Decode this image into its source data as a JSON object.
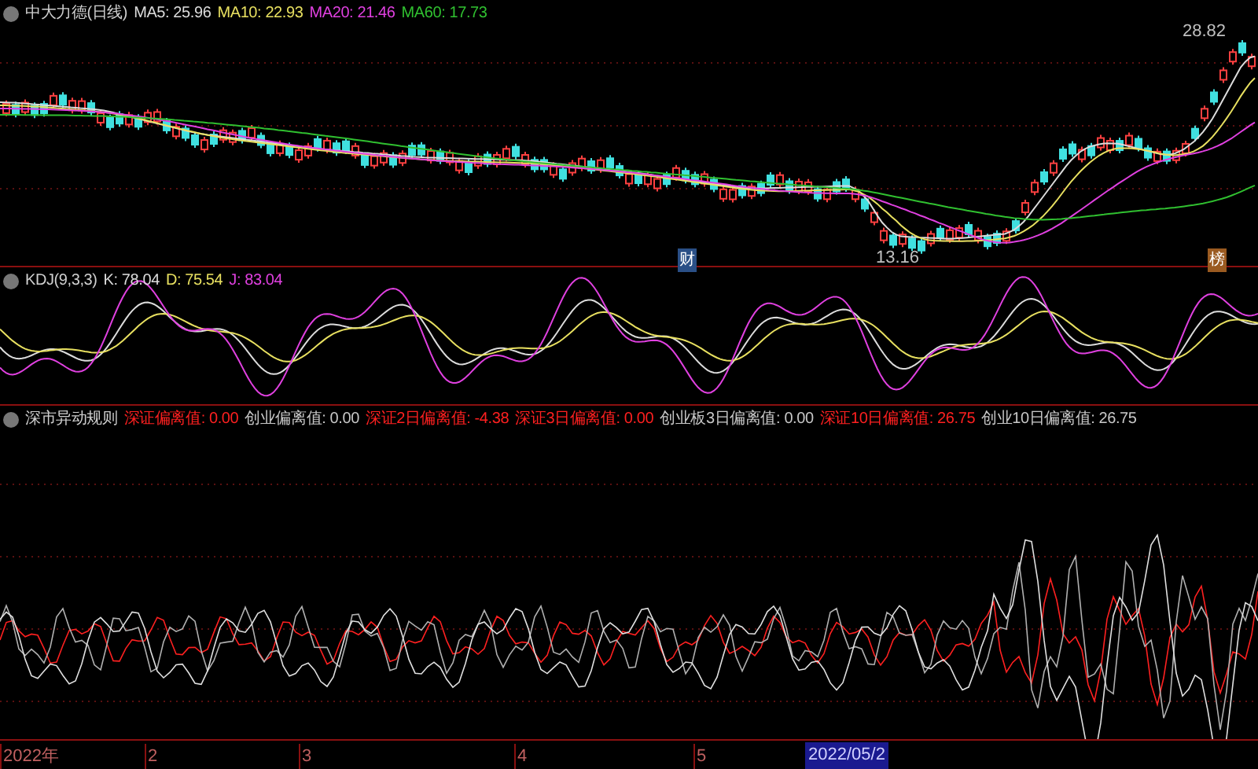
{
  "main_panel": {
    "title": "中大力德(日线)",
    "indicators": [
      {
        "label": "MA5: 25.96",
        "color": "#dcdcdc"
      },
      {
        "label": "MA10: 22.93",
        "color": "#e8e060"
      },
      {
        "label": "MA20: 21.46",
        "color": "#e040e0"
      },
      {
        "label": "MA60: 17.73",
        "color": "#30c030"
      }
    ],
    "high_label": "28.82",
    "low_label": "13.16",
    "event_markers": [
      {
        "text": "财",
        "color": "#2a4f86"
      },
      {
        "text": "榜",
        "color": "#9a5a20"
      }
    ]
  },
  "kdj_panel": {
    "title": "KDJ(9,3,3)",
    "indicators": [
      {
        "label": "K: 78.04",
        "color": "#dcdcdc"
      },
      {
        "label": "D: 75.54",
        "color": "#e8e060"
      },
      {
        "label": "J: 83.04",
        "color": "#e040e0"
      }
    ]
  },
  "signal_panel": {
    "title": "深市异动规则",
    "indicators": [
      {
        "label": "深证偏离值: 0.00",
        "color": "#ff2020"
      },
      {
        "label": "创业偏离值: 0.00",
        "color": "#c8c8c8"
      },
      {
        "label": "深证2日偏离值: -4.38",
        "color": "#ff2020"
      },
      {
        "label": "深证3日偏离值: 0.00",
        "color": "#ff2020"
      },
      {
        "label": "创业板3日偏离值: 0.00",
        "color": "#c8c8c8"
      },
      {
        "label": "深证10日偏离值: 26.75",
        "color": "#ff2020"
      },
      {
        "label": "创业10日偏离值: 26.75",
        "color": "#c8c8c8"
      }
    ]
  },
  "time_axis": {
    "labels": [
      "2022年",
      "2",
      "3",
      "4",
      "5"
    ],
    "current_label": "2022/05/2"
  }
}
